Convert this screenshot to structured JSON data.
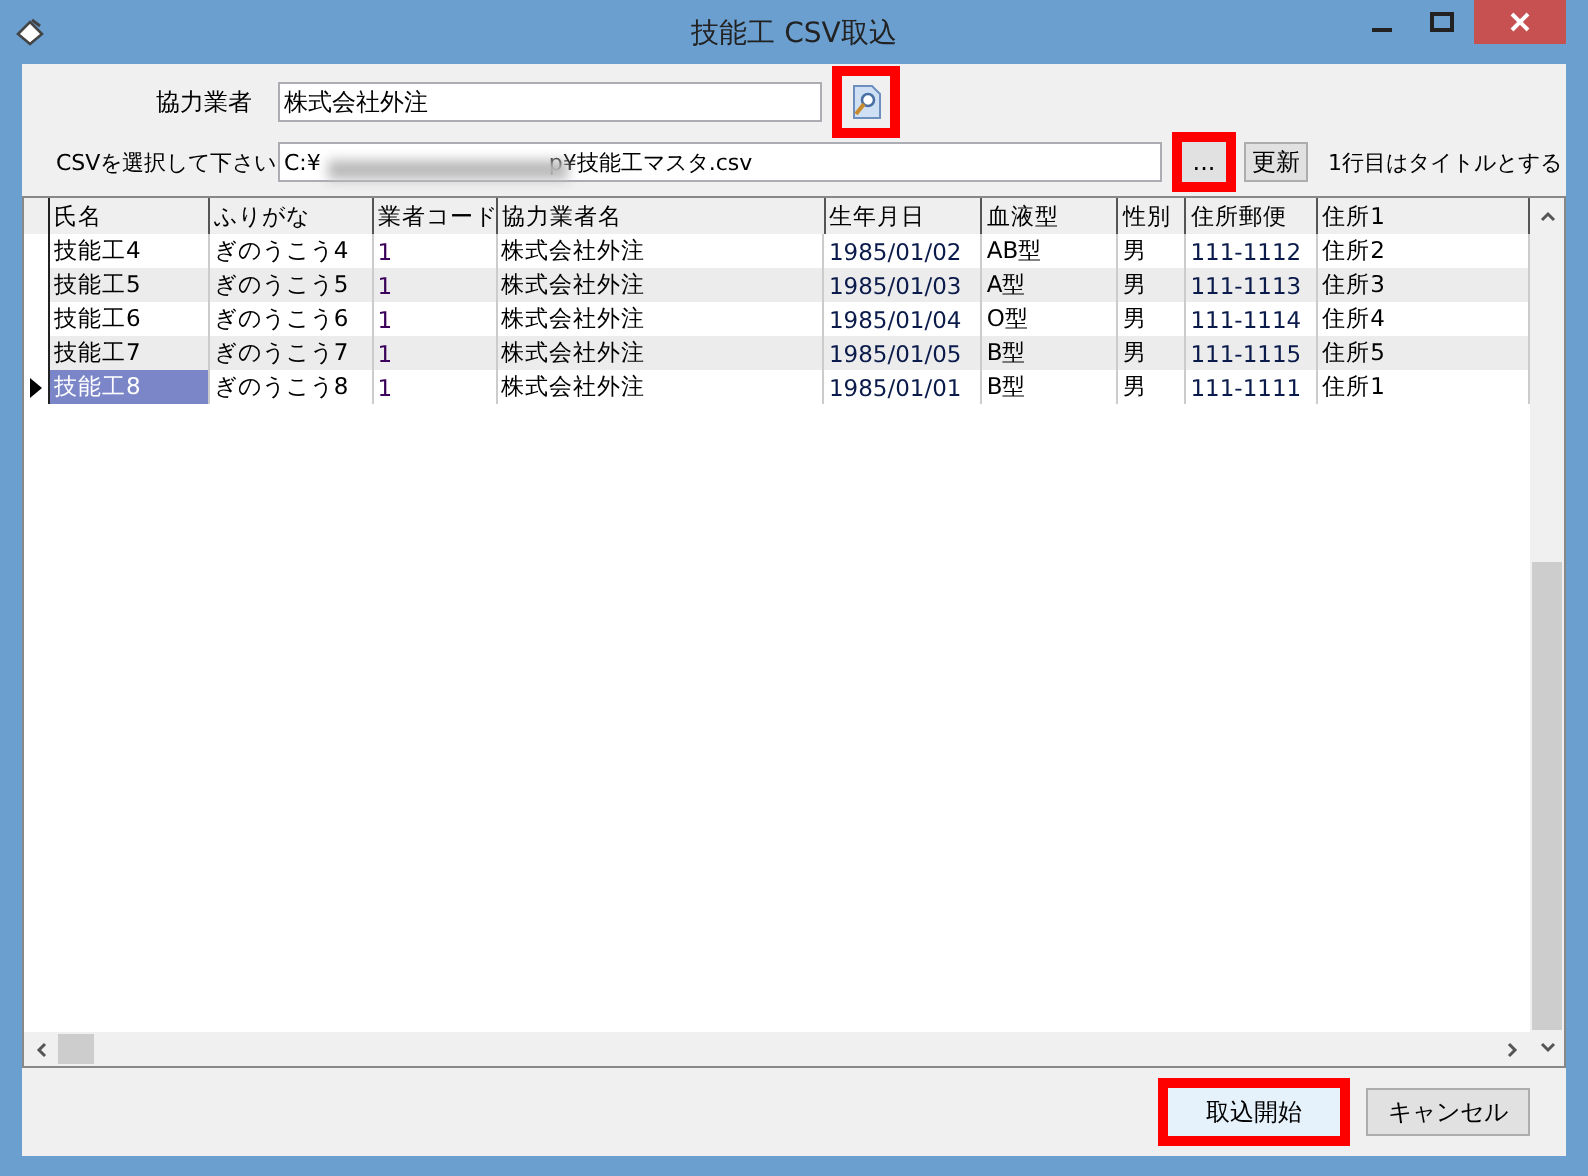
{
  "window": {
    "title": "技能工 CSV取込"
  },
  "partner": {
    "label": "協力業者",
    "value": "株式会社外注",
    "lookup_highlighted": true
  },
  "csv": {
    "label": "CSVを選択して下さい",
    "value_start": "C:¥",
    "value_end": "p¥技能工マスタ.csv",
    "browse": {
      "label": "...",
      "highlighted": true
    },
    "refresh": "更新",
    "note": "1行目はタイトルとする"
  },
  "table": {
    "columns": [
      "氏名",
      "ふりがな",
      "業者コード",
      "協力業者名",
      "生年月日",
      "血液型",
      "性別",
      "住所郵便",
      "住所1"
    ],
    "rows": [
      {
        "selected": false,
        "cells": [
          "技能工4",
          "ぎのうこう4",
          "1",
          "株式会社外注",
          "1985/01/02",
          "AB型",
          "男",
          "111-1112",
          "住所2"
        ]
      },
      {
        "selected": false,
        "cells": [
          "技能工5",
          "ぎのうこう5",
          "1",
          "株式会社外注",
          "1985/01/03",
          "A型",
          "男",
          "111-1113",
          "住所3"
        ]
      },
      {
        "selected": false,
        "cells": [
          "技能工6",
          "ぎのうこう6",
          "1",
          "株式会社外注",
          "1985/01/04",
          "O型",
          "男",
          "111-1114",
          "住所4"
        ]
      },
      {
        "selected": false,
        "cells": [
          "技能工7",
          "ぎのうこう7",
          "1",
          "株式会社外注",
          "1985/01/05",
          "B型",
          "男",
          "111-1115",
          "住所5"
        ]
      },
      {
        "selected": true,
        "cells": [
          "技能工8",
          "ぎのうこう8",
          "1",
          "株式会社外注",
          "1985/01/01",
          "B型",
          "男",
          "111-1111",
          "住所1"
        ]
      }
    ]
  },
  "buttons": [
    {
      "label": "取込開始",
      "highlighted": true
    },
    {
      "label": "キャンセル",
      "highlighted": false
    }
  ]
}
